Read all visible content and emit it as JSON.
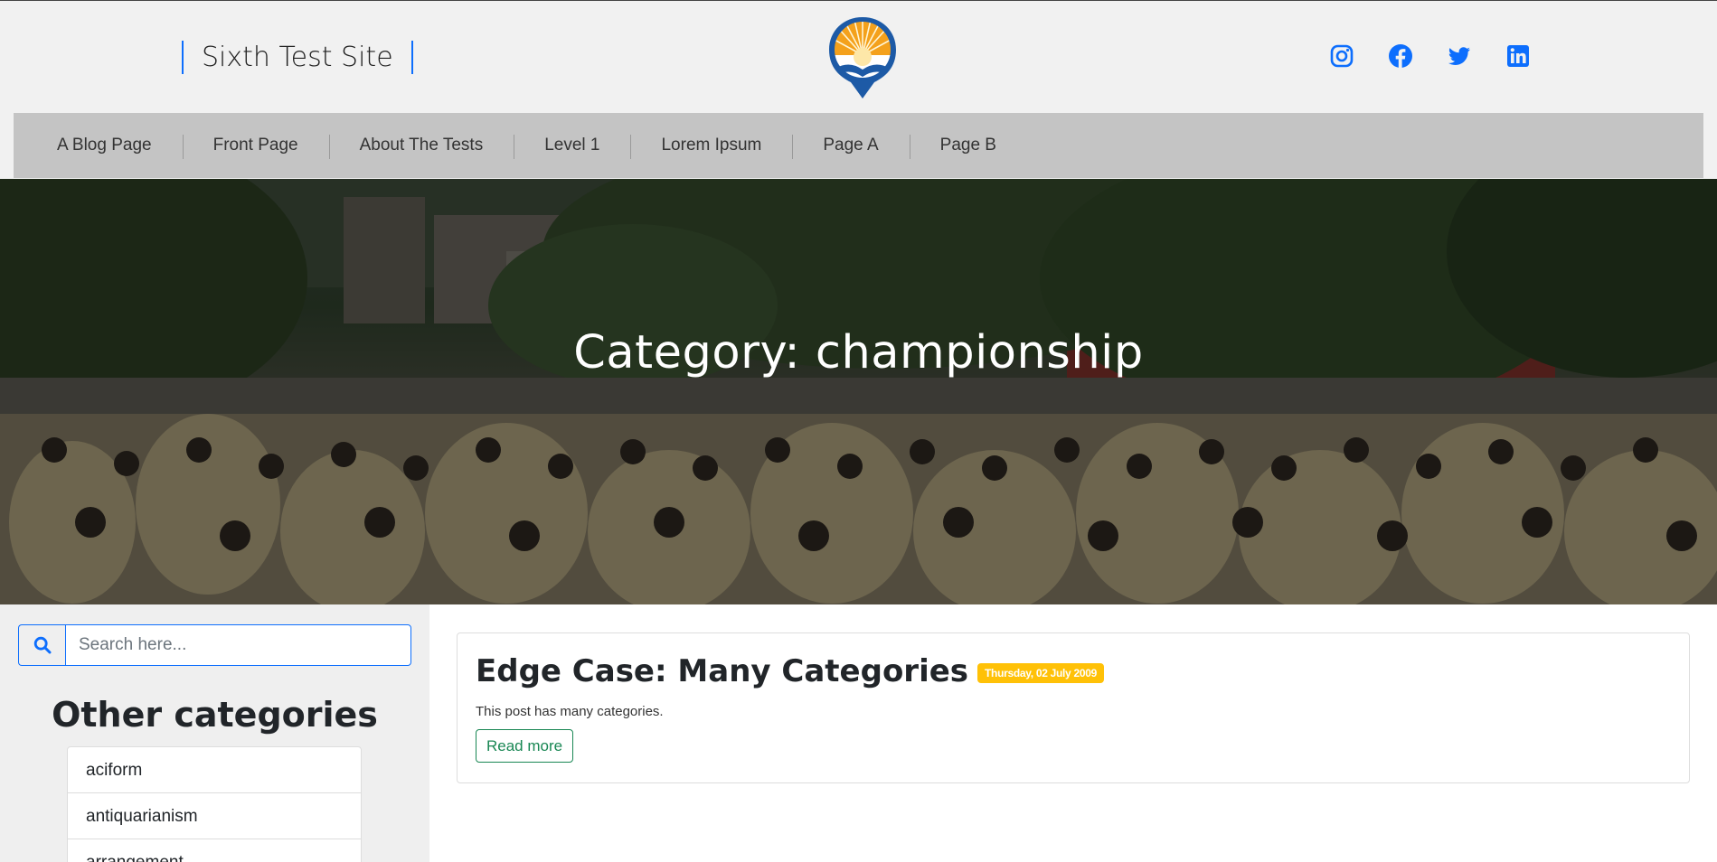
{
  "header": {
    "site_title": "Sixth Test Site",
    "socials": [
      "instagram-icon",
      "facebook-icon",
      "twitter-icon",
      "linkedin-icon"
    ]
  },
  "nav": {
    "items": [
      "A Blog Page",
      "Front Page",
      "About The Tests",
      "Level 1",
      "Lorem Ipsum",
      "Page A",
      "Page B"
    ]
  },
  "hero": {
    "title": "Category: championship"
  },
  "sidebar": {
    "search_placeholder": "Search here...",
    "search_icon": "search-icon",
    "categories_heading": "Other categories",
    "categories": [
      "aciform",
      "antiquarianism",
      "arrangement"
    ]
  },
  "post": {
    "title": "Edge Case: Many Categories",
    "date": "Thursday, 02 July 2009",
    "excerpt": "This post has many categories.",
    "read_more": "Read more"
  },
  "colors": {
    "accent": "#0d6efd",
    "nav_bg": "#c4c4c4",
    "badge": "#ffc107",
    "read_more": "#198754"
  }
}
